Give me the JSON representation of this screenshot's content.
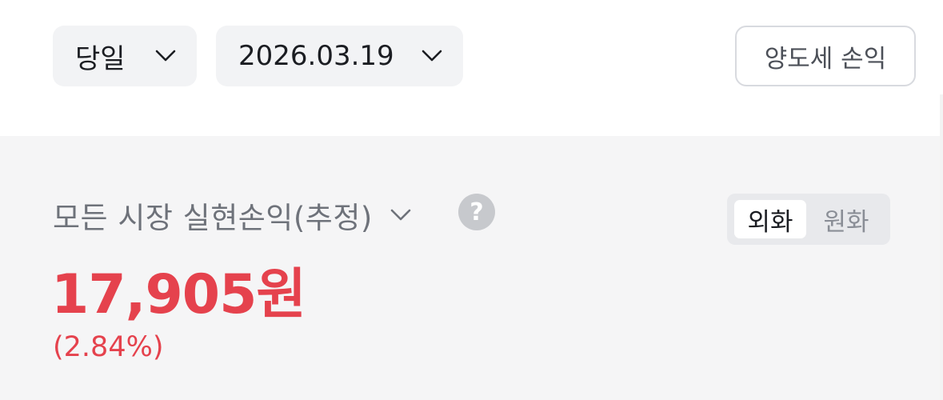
{
  "filters": {
    "period": "당일",
    "date": "2026.03.19",
    "tax_button": "양도세 손익"
  },
  "summary": {
    "title": "모든 시장 실현손익(추정)",
    "help_glyph": "?",
    "currency_options": [
      "외화",
      "원화"
    ],
    "selected_currency": "외화",
    "amount": "17,905원",
    "percent": "(2.84%)"
  },
  "icons": {
    "period_chevron": "chevron-down-icon",
    "date_chevron": "chevron-down-icon",
    "summary_chevron": "chevron-down-icon",
    "help": "question-circle-icon"
  },
  "colors": {
    "profit": "#e5424d",
    "panel_bg": "#f5f5f6",
    "pill_bg": "#f2f3f5"
  }
}
